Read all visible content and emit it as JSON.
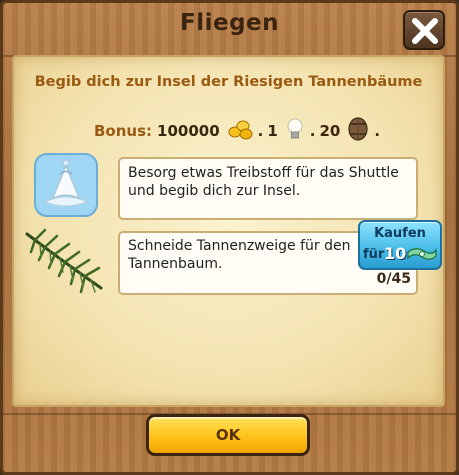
{
  "dialog": {
    "title": "Fliegen",
    "subtitle": "Begib dich zur Insel der Riesigen Tannenbäume"
  },
  "bonus": {
    "label": "Bonus:",
    "coins": "100000",
    "coins_icon": "gold-coins-icon",
    "bulbs": "1",
    "bulb_icon": "lightbulb-icon",
    "barrels": "20",
    "barrel_icon": "barrel-icon",
    "end": "."
  },
  "tasks": [
    {
      "icon": "shuttle-icon",
      "text": "Besorg etwas Treibstoff für das Shuttle und begib dich zur Insel."
    },
    {
      "icon": "fir-branch-icon",
      "text": "Schneide Tannenzweige für den Tannenbaum.",
      "progress": "0/45"
    }
  ],
  "buy_button": {
    "label": "Kaufen",
    "prefix": "für",
    "price": "10",
    "currency_icon": "banknote-icon"
  },
  "ok_button": {
    "label": "OK"
  },
  "colors": {
    "wood": "#a46c3a",
    "parchment": "#f4e3b0",
    "subtitle": "#9a5a12",
    "buy_button": "#4bbfe9",
    "ok_button": "#ffc21a"
  }
}
